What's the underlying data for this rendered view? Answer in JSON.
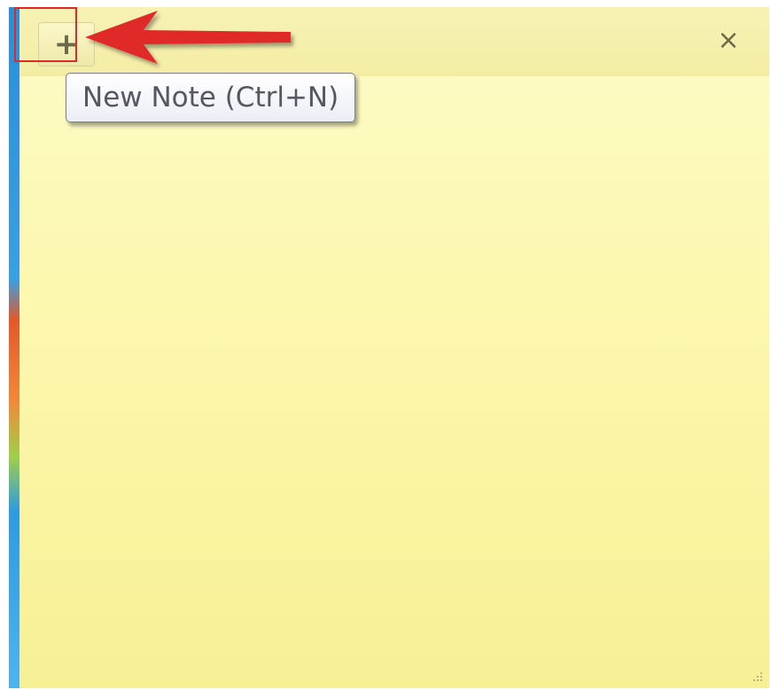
{
  "sticky_note": {
    "new_note_glyph": "+",
    "close_glyph": "×",
    "tooltip_text": "New Note (Ctrl+N)"
  },
  "annotation": {
    "highlight_color": "#e02a2a",
    "arrow_color": "#e02a2a"
  },
  "colors": {
    "note_background": "#fcf8b0",
    "note_titlebar": "#f3eda4",
    "tooltip_text": "#555762"
  },
  "icons": {
    "new_note": "plus-icon",
    "close": "close-icon",
    "resize": "resize-grip-icon"
  }
}
